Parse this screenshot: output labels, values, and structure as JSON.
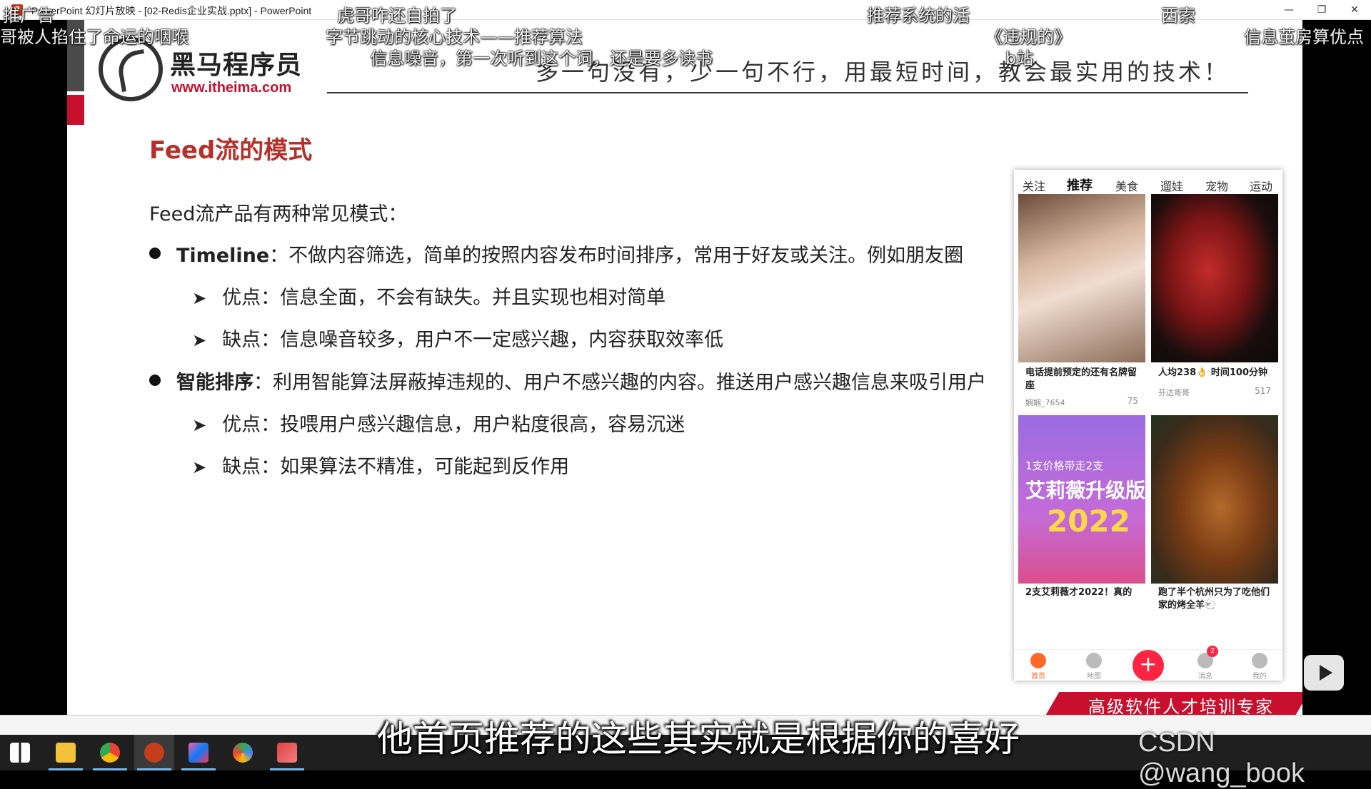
{
  "window": {
    "title": "PowerPoint 幻灯片放映 - [02-Redis企业实战.pptx] - PowerPoint",
    "app_icon": "P",
    "minimize": "—",
    "maximize": "❐",
    "close": "✕"
  },
  "slide": {
    "logo_cn": "黑马程序员",
    "logo_url": "www.itheima.com",
    "slogan": "多一句没有，少一句不行，用最短时间，教会最实用的技术！",
    "title": "Feed流的模式",
    "intro": "Feed流产品有两种常见模式：",
    "bullets": [
      {
        "term": "Timeline",
        "text": "：不做内容筛选，简单的按照内容发布时间排序，常用于好友或关注。例如朋友圈",
        "subs": [
          "优点：信息全面，不会有缺失。并且实现也相对简单",
          "缺点：信息噪音较多，用户不一定感兴趣，内容获取效率低"
        ]
      },
      {
        "term": "智能排序",
        "text": "：利用智能算法屏蔽掉违规的、用户不感兴趣的内容。推送用户感兴趣信息来吸引用户",
        "subs": [
          "优点：投喂用户感兴趣信息，用户粘度很高，容易沉迷",
          "缺点：如果算法不精准，可能起到反作用"
        ]
      }
    ],
    "footer": "高级软件人才培训专家"
  },
  "phone": {
    "tabs": [
      "关注",
      "推荐",
      "美食",
      "遛娃",
      "宠物",
      "运动健"
    ],
    "active_tab": "推荐",
    "cards": [
      {
        "caption": "电话提前预定的还有名牌留座",
        "user": "娴娴_7654",
        "likes": "75"
      },
      {
        "caption": "人均238👌 时间100分钟",
        "user": "芬达哥哥",
        "likes": "517"
      },
      {
        "caption": "2支艾莉薇才2022！真的",
        "promo_1": "1支价格带走2支",
        "promo_2": "艾莉薇升级版",
        "promo_3": "2022"
      },
      {
        "caption": "跑了半个杭州只为了吃他们家的烤全羊🐑"
      }
    ],
    "nav": [
      "首页",
      "地图",
      "消息",
      "我的"
    ],
    "badge": "2",
    "plus": "+"
  },
  "overlay": {
    "danmaku": [
      "推广告",
      "哥被人掐住了命运的咽喉",
      "虎哥咋还自拍了",
      "字节跳动的核心技术——推荐算法",
      "信息噪音，第一次听到这个词，还是要多读书",
      "推荐系统的活",
      "《违规的》",
      "b站",
      "西索",
      "信息茧房算优点"
    ],
    "subtitle": "他首页推荐的这些其实就是根据你的喜好",
    "watermark": "CSDN @wang_book"
  },
  "colors": {
    "accent_red": "#c8102e",
    "title_red": "#b5302a",
    "xhs_red": "#ff2442"
  }
}
